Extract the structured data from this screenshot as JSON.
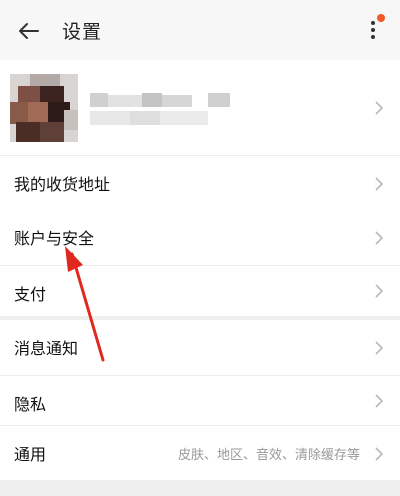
{
  "header": {
    "title": "设置",
    "back_icon": "back-arrow-icon",
    "more_icon": "more-vert-icon",
    "badge_color": "#f05a24"
  },
  "profile": {
    "avatar_icon": "avatar",
    "name_redacted": true
  },
  "rows": {
    "address": "我的收货地址",
    "account": "账户与安全",
    "pay": "支付",
    "notify": "消息通知",
    "privacy": "隐私",
    "general": "通用",
    "general_sub": "皮肤、地区、音效、清除缓存等"
  },
  "annotation": {
    "color": "#e0281e"
  }
}
